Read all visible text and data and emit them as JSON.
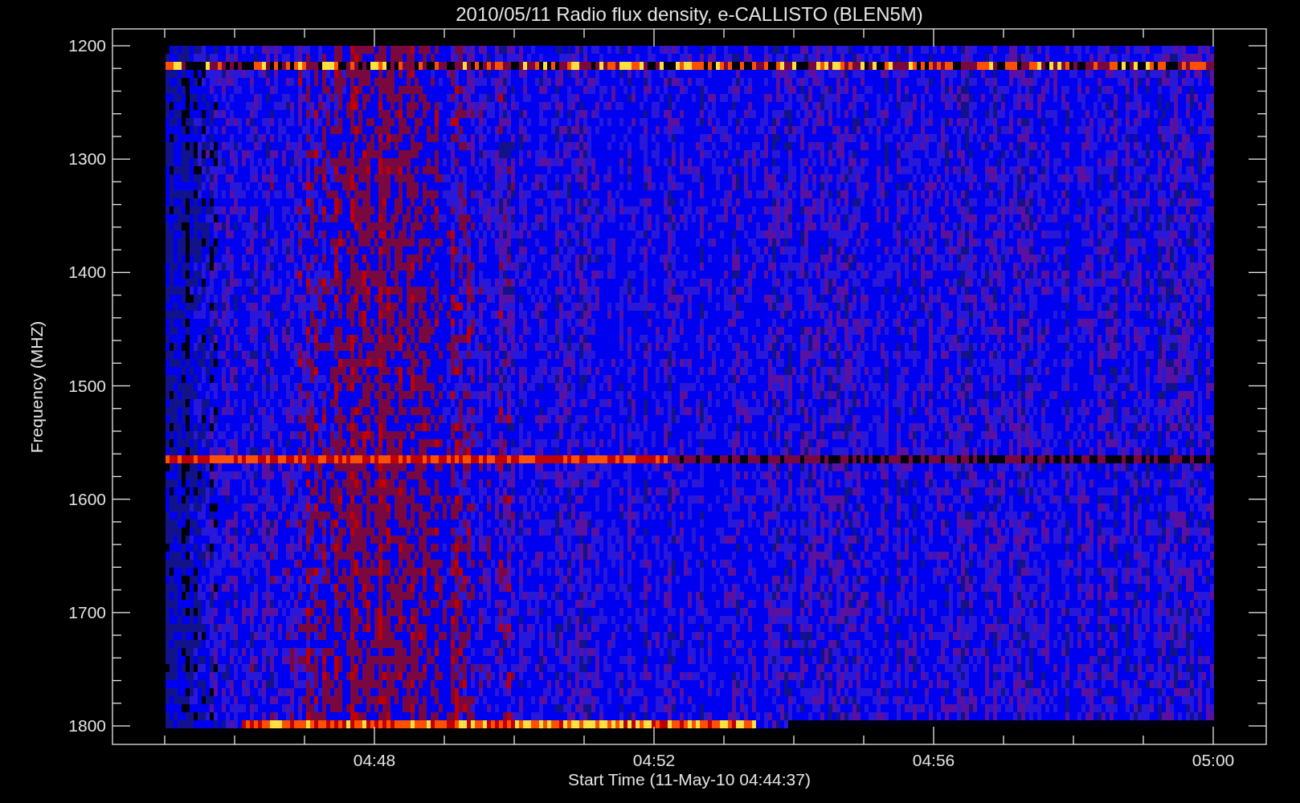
{
  "title": "2010/05/11  Radio flux density, e-CALLISTO (BLEN5M)",
  "y_axis": {
    "label": "Frequency (MHZ)",
    "ticks": [
      "1200",
      "1300",
      "1400",
      "1500",
      "1600",
      "1700",
      "1800"
    ]
  },
  "x_axis": {
    "label": "Start Time (11-May-10 04:44:37)",
    "ticks": [
      "04:48",
      "04:52",
      "04:56",
      "05:00"
    ]
  }
}
